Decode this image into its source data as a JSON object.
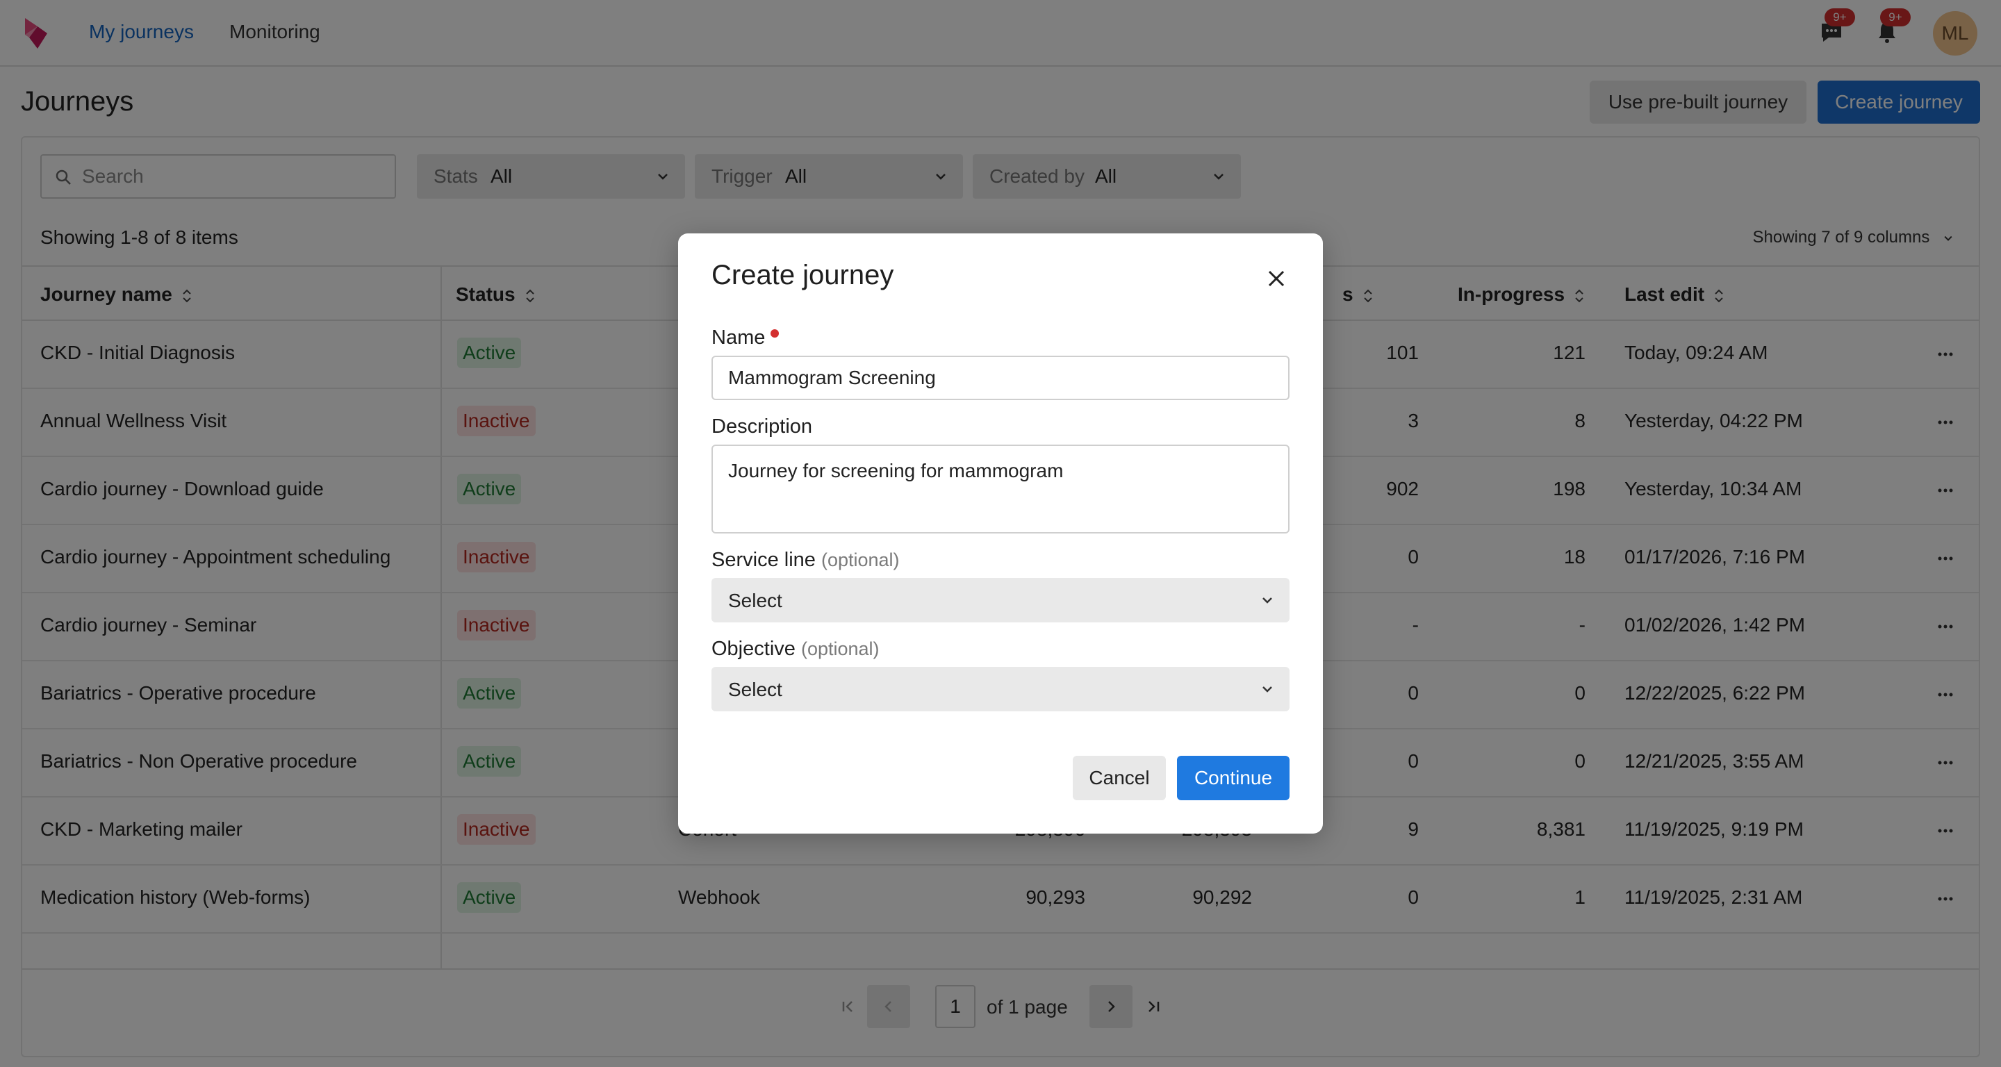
{
  "nav": {
    "links": [
      "My journeys",
      "Monitoring"
    ],
    "messages_badge": "9+",
    "notifications_badge": "9+",
    "avatar_initials": "ML"
  },
  "header": {
    "title": "Journeys",
    "prebuilt_label": "Use pre-built journey",
    "create_label": "Create journey"
  },
  "toolbar": {
    "search_placeholder": "Search",
    "filters": [
      {
        "label": "Stats",
        "value": "All"
      },
      {
        "label": "Trigger",
        "value": "All"
      },
      {
        "label": "Created by",
        "value": "All"
      }
    ],
    "showing": "Showing 1-8 of 8 items",
    "columns_toggle": "Showing 7 of 9 columns"
  },
  "table": {
    "headers": {
      "name": "Journey name",
      "status": "Status",
      "col_partial": "s",
      "in_progress": "In-progress",
      "last_edit": "Last edit"
    },
    "rows": [
      {
        "name": "CKD - Initial Diagnosis",
        "status": "Active",
        "col_s": "101",
        "in_progress": "121",
        "last_edit": "Today, 09:24 AM"
      },
      {
        "name": "Annual Wellness Visit",
        "status": "Inactive",
        "col_s": "3",
        "in_progress": "8",
        "last_edit": "Yesterday, 04:22 PM"
      },
      {
        "name": "Cardio journey - Download guide",
        "status": "Active",
        "col_s": "902",
        "in_progress": "198",
        "last_edit": "Yesterday, 10:34 AM"
      },
      {
        "name": "Cardio journey - Appointment scheduling",
        "status": "Inactive",
        "col_s": "0",
        "in_progress": "18",
        "last_edit": "01/17/2026, 7:16 PM"
      },
      {
        "name": "Cardio journey - Seminar",
        "status": "Inactive",
        "col_s": "-",
        "in_progress": "-",
        "last_edit": "01/02/2026, 1:42 PM"
      },
      {
        "name": "Bariatrics - Operative procedure",
        "status": "Active",
        "col_s": "0",
        "in_progress": "0",
        "last_edit": "12/22/2025, 6:22 PM"
      },
      {
        "name": "Bariatrics - Non Operative procedure",
        "status": "Active",
        "col_s": "0",
        "in_progress": "0",
        "last_edit": "12/21/2025, 3:55 AM"
      },
      {
        "name": "CKD - Marketing mailer",
        "status": "Inactive",
        "trigger": "Cohort",
        "col_a": "298,396",
        "col_b": "298,393",
        "col_s": "9",
        "in_progress": "8,381",
        "last_edit": "11/19/2025, 9:19 PM"
      },
      {
        "name": "Medication history (Web-forms)",
        "status": "Active",
        "trigger": "Webhook",
        "col_a": "90,293",
        "col_b": "90,292",
        "col_s": "0",
        "in_progress": "1",
        "last_edit": "11/19/2025, 2:31 AM"
      }
    ]
  },
  "pagination": {
    "page": "1",
    "of_label": "of 1 page"
  },
  "modal": {
    "title": "Create journey",
    "name_label": "Name",
    "name_value": "Mammogram Screening",
    "description_label": "Description",
    "description_value": "Journey for screening for mammogram",
    "service_line_label": "Service line",
    "service_line_optional": "(optional)",
    "service_line_value": "Select",
    "objective_label": "Objective",
    "objective_optional": "(optional)",
    "objective_value": "Select",
    "cancel_label": "Cancel",
    "continue_label": "Continue"
  },
  "colors": {
    "primary": "#1f6fd1",
    "active_bg": "#dff3e3",
    "active_text": "#1e7a35",
    "inactive_bg": "#fde0e0",
    "inactive_text": "#b3261e",
    "required_dot": "#d32f2f"
  }
}
